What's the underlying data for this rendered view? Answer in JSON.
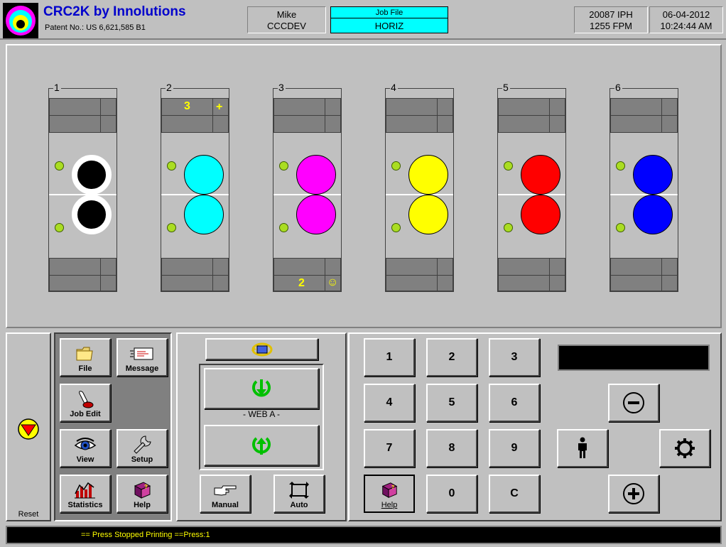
{
  "header": {
    "title": "CRC2K by Innolutions",
    "patent": "Patent No.: US 6,621,585 B1",
    "user": "Mike",
    "host": "CCCDEV",
    "job_label": "Job File",
    "job_value": "HORIZ",
    "iph": "20087 IPH",
    "fpm": "1255 FPM",
    "date": "06-04-2012",
    "time": "10:24:44 AM"
  },
  "units": [
    {
      "num": "1",
      "color": "#000000",
      "ring": "#ffffff"
    },
    {
      "num": "2",
      "color": "#00ffff",
      "top_value": "3",
      "top_symbol": "+"
    },
    {
      "num": "3",
      "color": "#ff00ff",
      "bottom_value": "2",
      "bottom_symbol": "☺"
    },
    {
      "num": "4",
      "color": "#ffff00"
    },
    {
      "num": "5",
      "color": "#ff0000"
    },
    {
      "num": "6",
      "color": "#0000ff"
    }
  ],
  "left_panel": {
    "reset_label": "Reset",
    "buttons": {
      "file": "File",
      "message": "Message",
      "job_edit": "Job Edit",
      "view": "View",
      "setup": "Setup",
      "statistics": "Statistics",
      "help": "Help"
    }
  },
  "web_panel": {
    "web_label": "- WEB A -",
    "manual": "Manual",
    "auto": "Auto"
  },
  "keypad": {
    "keys": [
      "1",
      "2",
      "3",
      "4",
      "5",
      "6",
      "7",
      "8",
      "9",
      "0",
      "C"
    ],
    "help": "Help",
    "display_value": ""
  },
  "status": {
    "message": "== Press Stopped Printing  ==Press:1"
  },
  "icons": [
    "folder-icon",
    "message-icon",
    "job-edit-icon",
    "eye-icon",
    "wrench-icon",
    "statistics-icon",
    "help-book-icon",
    "reset-icon",
    "sync-icon",
    "down-arrow-icon",
    "up-arrow-icon",
    "pointing-hand-icon",
    "auto-frame-icon",
    "minus-icon",
    "plus-icon",
    "person-icon",
    "gear-icon"
  ]
}
